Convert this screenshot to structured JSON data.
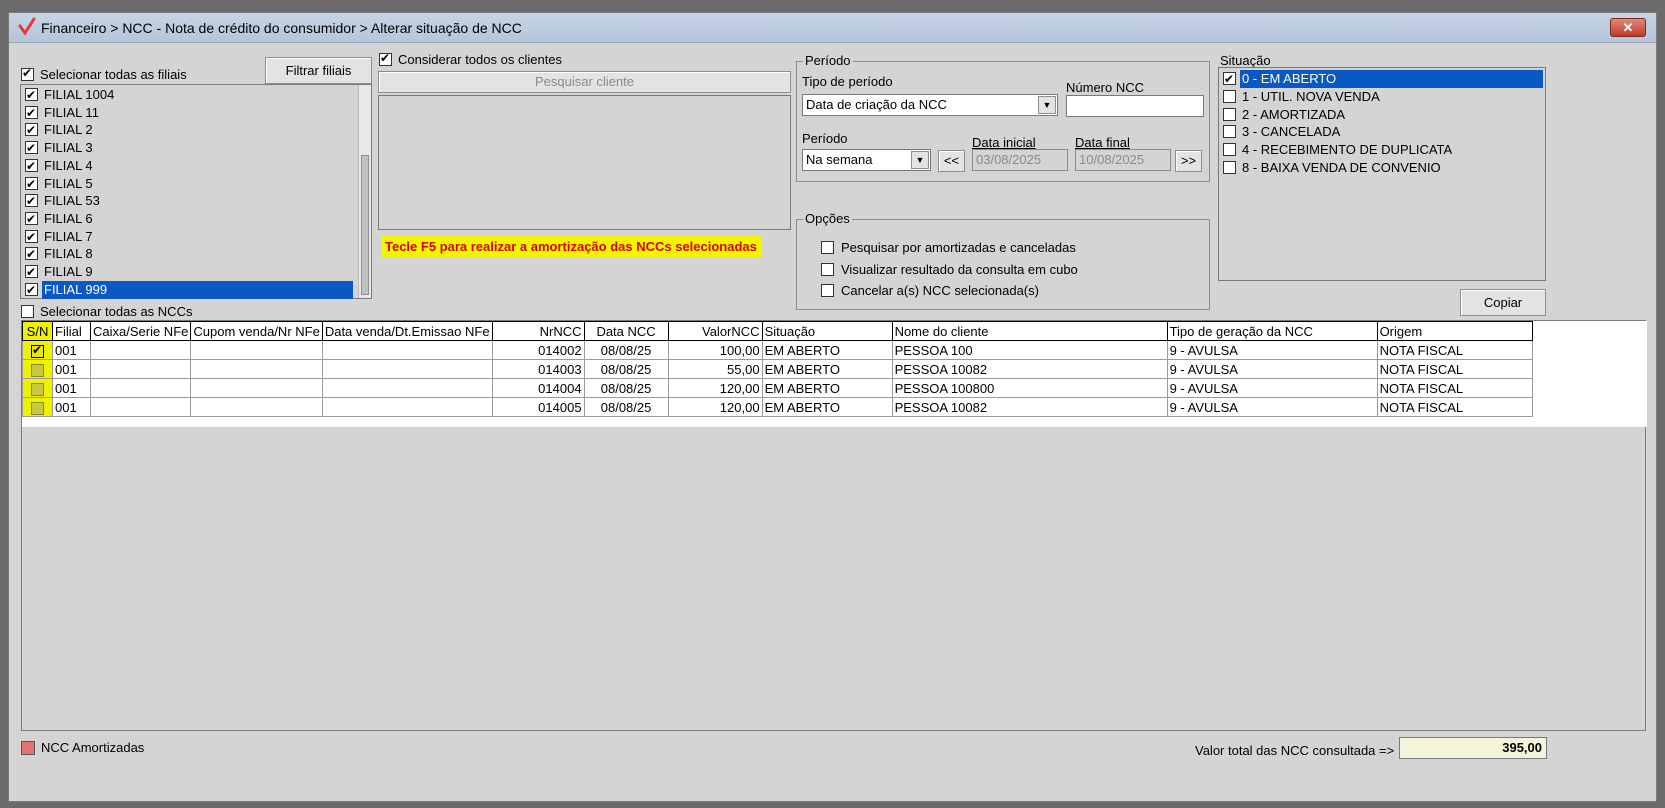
{
  "window": {
    "title": "Financeiro > NCC - Nota de crédito do consumidor > Alterar situação de NCC",
    "close_label": "✕"
  },
  "filiais": {
    "select_all_label": "Selecionar todas as filiais",
    "filter_button": "Filtrar filiais",
    "items": [
      {
        "label": "FILIAL 1004",
        "checked": true
      },
      {
        "label": "FILIAL 11",
        "checked": true
      },
      {
        "label": "FILIAL 2",
        "checked": true
      },
      {
        "label": "FILIAL 3",
        "checked": true
      },
      {
        "label": "FILIAL 4",
        "checked": true
      },
      {
        "label": "FILIAL 5",
        "checked": true
      },
      {
        "label": "FILIAL 53",
        "checked": true
      },
      {
        "label": "FILIAL 6",
        "checked": true
      },
      {
        "label": "FILIAL 7",
        "checked": true
      },
      {
        "label": "FILIAL 8",
        "checked": true
      },
      {
        "label": "FILIAL 9",
        "checked": true
      },
      {
        "label": "FILIAL 999",
        "checked": true,
        "selected": true
      }
    ]
  },
  "clientes": {
    "consider_all_label": "Considerar todos os clientes",
    "search_button": "Pesquisar cliente"
  },
  "warning": "Tecle F5 para realizar a amortização das NCCs selecionadas",
  "periodo": {
    "group_title": "Período",
    "tipo_label": "Tipo de período",
    "tipo_value": "Data de criação da NCC",
    "numero_label": "Número NCC",
    "numero_value": "",
    "periodo_label": "Período",
    "periodo_value": "Na semana",
    "prev_button": "<<",
    "next_button": ">>",
    "data_inicial_label": "Data inicial",
    "data_inicial_value": "03/08/2025",
    "data_final_label": "Data final",
    "data_final_value": "10/08/2025"
  },
  "opcoes": {
    "group_title": "Opções",
    "items": [
      "Pesquisar por amortizadas e canceladas",
      "Visualizar resultado da consulta em cubo",
      "Cancelar a(s) NCC selecionada(s)"
    ]
  },
  "situacao": {
    "group_title": "Situação",
    "items": [
      {
        "label": "0 - EM ABERTO",
        "checked": true,
        "selected": true
      },
      {
        "label": "1 - UTIL. NOVA VENDA",
        "checked": false
      },
      {
        "label": "2 - AMORTIZADA",
        "checked": false
      },
      {
        "label": "3 - CANCELADA",
        "checked": false
      },
      {
        "label": "4 - RECEBIMENTO DE DUPLICATA",
        "checked": false
      },
      {
        "label": "8 - BAIXA VENDA DE CONVENIO",
        "checked": false
      }
    ]
  },
  "copy_button": "Copiar",
  "select_all_ncc_label": "Selecionar todas as NCCs",
  "grid": {
    "columns": [
      "S/N",
      "Filial",
      "Caixa/Serie NFe",
      "Cupom venda/Nr NFe",
      "Data venda/Dt.Emissao NFe",
      "NrNCC",
      "Data NCC",
      "ValorNCC",
      "Situação",
      "Nome do cliente",
      "Tipo de geração da NCC",
      "Origem"
    ],
    "rows": [
      {
        "checked": true,
        "filial": "001",
        "caixa": "",
        "cupom": "",
        "data_venda": "",
        "nrncc": "014002",
        "data_ncc": "08/08/25",
        "valor": "100,00",
        "situacao": "EM ABERTO",
        "cliente": "PESSOA 100",
        "tipo": "9 - AVULSA",
        "origem": "NOTA FISCAL"
      },
      {
        "checked": false,
        "filial": "001",
        "caixa": "",
        "cupom": "",
        "data_venda": "",
        "nrncc": "014003",
        "data_ncc": "08/08/25",
        "valor": "55,00",
        "situacao": "EM ABERTO",
        "cliente": "PESSOA 10082",
        "tipo": "9 - AVULSA",
        "origem": "NOTA FISCAL"
      },
      {
        "checked": false,
        "filial": "001",
        "caixa": "",
        "cupom": "",
        "data_venda": "",
        "nrncc": "014004",
        "data_ncc": "08/08/25",
        "valor": "120,00",
        "situacao": "EM ABERTO",
        "cliente": "PESSOA 100800",
        "tipo": "9 - AVULSA",
        "origem": "NOTA FISCAL"
      },
      {
        "checked": false,
        "filial": "001",
        "caixa": "",
        "cupom": "",
        "data_venda": "",
        "nrncc": "014005",
        "data_ncc": "08/08/25",
        "valor": "120,00",
        "situacao": "EM ABERTO",
        "cliente": "PESSOA 10082",
        "tipo": "9 - AVULSA",
        "origem": "NOTA FISCAL"
      }
    ]
  },
  "footer": {
    "legend_label": "NCC Amortizadas",
    "legend_color": "#e57373",
    "total_label": "Valor total das NCC consultada =>",
    "total_value": "395,00"
  }
}
